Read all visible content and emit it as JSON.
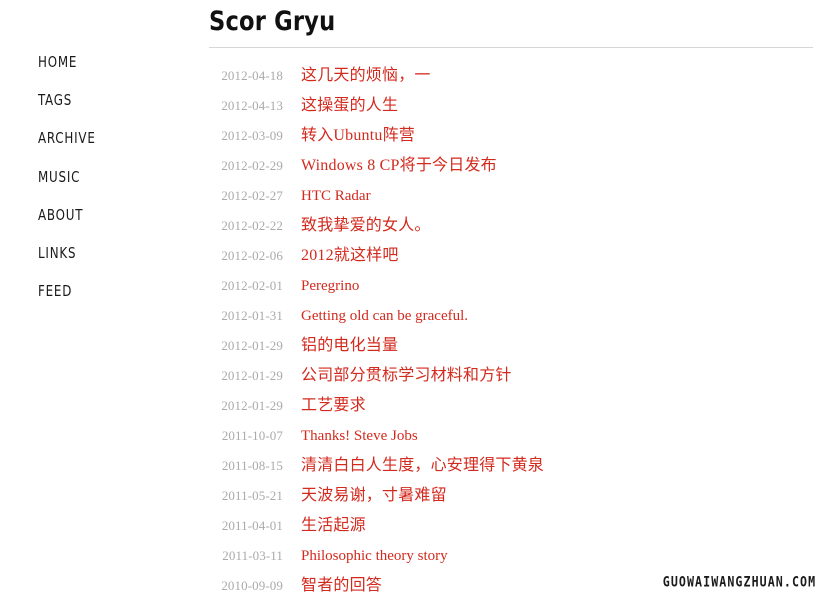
{
  "site": {
    "title": "Scor Gryu"
  },
  "sidebar": {
    "items": [
      {
        "label": "HOME"
      },
      {
        "label": "TAGS"
      },
      {
        "label": "ARCHIVE"
      },
      {
        "label": "MUSIC"
      },
      {
        "label": "ABOUT"
      },
      {
        "label": "LINKS"
      },
      {
        "label": "FEED"
      }
    ]
  },
  "posts": [
    {
      "date": "2012-04-18",
      "title": "这几天的烦恼，一",
      "cjk": true
    },
    {
      "date": "2012-04-13",
      "title": "这操蛋的人生",
      "cjk": true
    },
    {
      "date": "2012-03-09",
      "title": "转入Ubuntu阵营",
      "cjk": true
    },
    {
      "date": "2012-02-29",
      "title": "Windows 8 CP将于今日发布",
      "cjk": true
    },
    {
      "date": "2012-02-27",
      "title": "HTC Radar",
      "cjk": false
    },
    {
      "date": "2012-02-22",
      "title": "致我挚爱的女人。",
      "cjk": true
    },
    {
      "date": "2012-02-06",
      "title": "2012就这样吧",
      "cjk": true
    },
    {
      "date": "2012-02-01",
      "title": "Peregrino",
      "cjk": false
    },
    {
      "date": "2012-01-31",
      "title": "Getting old can be graceful.",
      "cjk": false
    },
    {
      "date": "2012-01-29",
      "title": "铝的电化当量",
      "cjk": true
    },
    {
      "date": "2012-01-29",
      "title": "公司部分贯标学习材料和方针",
      "cjk": true
    },
    {
      "date": "2012-01-29",
      "title": "工艺要求",
      "cjk": true
    },
    {
      "date": "2011-10-07",
      "title": "Thanks! Steve Jobs",
      "cjk": false
    },
    {
      "date": "2011-08-15",
      "title": "清清白白人生度，心安理得下黄泉",
      "cjk": true
    },
    {
      "date": "2011-05-21",
      "title": "天波易谢，寸暑难留",
      "cjk": true
    },
    {
      "date": "2011-04-01",
      "title": "生活起源",
      "cjk": true
    },
    {
      "date": "2011-03-11",
      "title": "Philosophic theory story",
      "cjk": false
    },
    {
      "date": "2010-09-09",
      "title": "智者的回答",
      "cjk": true
    }
  ],
  "watermark": {
    "text": "GUOWAIWANGZHUAN.COM"
  },
  "colors": {
    "link": "#d32a1e",
    "date": "#aaaaaa",
    "nav": "#1a1a1a",
    "rule": "#d6d6d6",
    "background": "#ffffff"
  }
}
